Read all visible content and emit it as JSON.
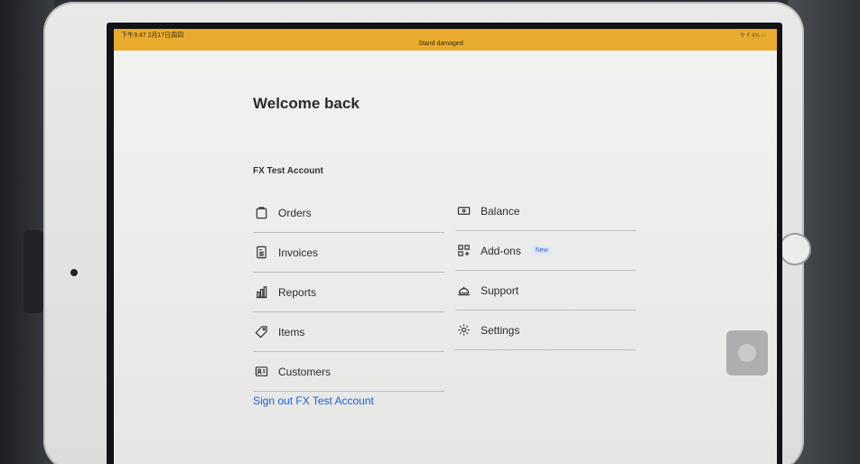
{
  "status_bar": {
    "time": "下午3:47  2月17日周四",
    "banner": "Stand damaged",
    "right_indicators": "令 ∜ 4% ▭"
  },
  "header": {
    "title": "Welcome back"
  },
  "account": {
    "name": "FX Test Account"
  },
  "menu_left": [
    {
      "label": "Orders",
      "icon": "clipboard-icon"
    },
    {
      "label": "Invoices",
      "icon": "invoice-icon"
    },
    {
      "label": "Reports",
      "icon": "bar-chart-icon"
    },
    {
      "label": "Items",
      "icon": "tag-icon"
    },
    {
      "label": "Customers",
      "icon": "contact-card-icon"
    }
  ],
  "menu_right": [
    {
      "label": "Balance",
      "icon": "banknote-icon"
    },
    {
      "label": "Add-ons",
      "icon": "grid-plus-icon",
      "badge": "New"
    },
    {
      "label": "Support",
      "icon": "service-bell-icon"
    },
    {
      "label": "Settings",
      "icon": "gear-icon"
    }
  ],
  "signout": {
    "label": "Sign out FX Test Account"
  },
  "colors": {
    "status_bar": "#e8ab2e",
    "link": "#1f5fd8",
    "text": "#2c2c2e"
  }
}
